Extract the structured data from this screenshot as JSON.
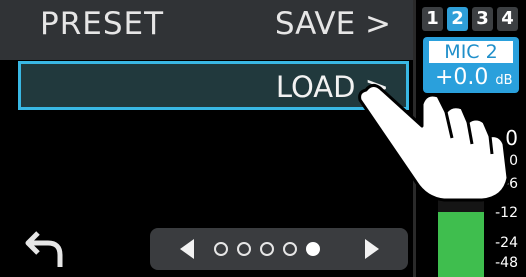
{
  "preset_screen": {
    "title": "PRESET",
    "save_label": "SAVE >",
    "load_label": "LOAD >"
  },
  "pager": {
    "prev_icon": "triangle-left-icon",
    "next_icon": "triangle-right-icon",
    "page_count": 5,
    "active_page": 5
  },
  "channel_panel": {
    "tabs": [
      "1",
      "2",
      "3",
      "4"
    ],
    "active_tab": "2",
    "mic_name": "MIC 2",
    "gain_value": "+0.0",
    "gain_unit": "dB",
    "meter_scale": [
      "0",
      "-6",
      "-12",
      "-24",
      "-48"
    ],
    "meter_level_db": -12,
    "peak_hint": "0"
  },
  "colors": {
    "accent_blue": "#2aa0dc",
    "selection_border": "#39b8e4",
    "meter_green": "#3fbe4e"
  }
}
